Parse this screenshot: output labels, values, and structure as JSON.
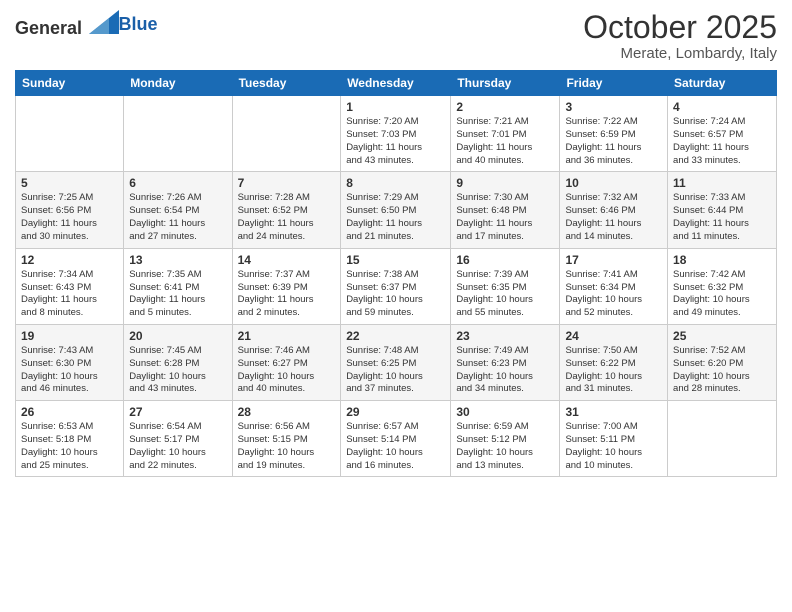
{
  "logo": {
    "general": "General",
    "blue": "Blue"
  },
  "title": {
    "month": "October 2025",
    "location": "Merate, Lombardy, Italy"
  },
  "days_of_week": [
    "Sunday",
    "Monday",
    "Tuesday",
    "Wednesday",
    "Thursday",
    "Friday",
    "Saturday"
  ],
  "weeks": [
    [
      {
        "day": "",
        "info": ""
      },
      {
        "day": "",
        "info": ""
      },
      {
        "day": "",
        "info": ""
      },
      {
        "day": "1",
        "info": "Sunrise: 7:20 AM\nSunset: 7:03 PM\nDaylight: 11 hours\nand 43 minutes."
      },
      {
        "day": "2",
        "info": "Sunrise: 7:21 AM\nSunset: 7:01 PM\nDaylight: 11 hours\nand 40 minutes."
      },
      {
        "day": "3",
        "info": "Sunrise: 7:22 AM\nSunset: 6:59 PM\nDaylight: 11 hours\nand 36 minutes."
      },
      {
        "day": "4",
        "info": "Sunrise: 7:24 AM\nSunset: 6:57 PM\nDaylight: 11 hours\nand 33 minutes."
      }
    ],
    [
      {
        "day": "5",
        "info": "Sunrise: 7:25 AM\nSunset: 6:56 PM\nDaylight: 11 hours\nand 30 minutes."
      },
      {
        "day": "6",
        "info": "Sunrise: 7:26 AM\nSunset: 6:54 PM\nDaylight: 11 hours\nand 27 minutes."
      },
      {
        "day": "7",
        "info": "Sunrise: 7:28 AM\nSunset: 6:52 PM\nDaylight: 11 hours\nand 24 minutes."
      },
      {
        "day": "8",
        "info": "Sunrise: 7:29 AM\nSunset: 6:50 PM\nDaylight: 11 hours\nand 21 minutes."
      },
      {
        "day": "9",
        "info": "Sunrise: 7:30 AM\nSunset: 6:48 PM\nDaylight: 11 hours\nand 17 minutes."
      },
      {
        "day": "10",
        "info": "Sunrise: 7:32 AM\nSunset: 6:46 PM\nDaylight: 11 hours\nand 14 minutes."
      },
      {
        "day": "11",
        "info": "Sunrise: 7:33 AM\nSunset: 6:44 PM\nDaylight: 11 hours\nand 11 minutes."
      }
    ],
    [
      {
        "day": "12",
        "info": "Sunrise: 7:34 AM\nSunset: 6:43 PM\nDaylight: 11 hours\nand 8 minutes."
      },
      {
        "day": "13",
        "info": "Sunrise: 7:35 AM\nSunset: 6:41 PM\nDaylight: 11 hours\nand 5 minutes."
      },
      {
        "day": "14",
        "info": "Sunrise: 7:37 AM\nSunset: 6:39 PM\nDaylight: 11 hours\nand 2 minutes."
      },
      {
        "day": "15",
        "info": "Sunrise: 7:38 AM\nSunset: 6:37 PM\nDaylight: 10 hours\nand 59 minutes."
      },
      {
        "day": "16",
        "info": "Sunrise: 7:39 AM\nSunset: 6:35 PM\nDaylight: 10 hours\nand 55 minutes."
      },
      {
        "day": "17",
        "info": "Sunrise: 7:41 AM\nSunset: 6:34 PM\nDaylight: 10 hours\nand 52 minutes."
      },
      {
        "day": "18",
        "info": "Sunrise: 7:42 AM\nSunset: 6:32 PM\nDaylight: 10 hours\nand 49 minutes."
      }
    ],
    [
      {
        "day": "19",
        "info": "Sunrise: 7:43 AM\nSunset: 6:30 PM\nDaylight: 10 hours\nand 46 minutes."
      },
      {
        "day": "20",
        "info": "Sunrise: 7:45 AM\nSunset: 6:28 PM\nDaylight: 10 hours\nand 43 minutes."
      },
      {
        "day": "21",
        "info": "Sunrise: 7:46 AM\nSunset: 6:27 PM\nDaylight: 10 hours\nand 40 minutes."
      },
      {
        "day": "22",
        "info": "Sunrise: 7:48 AM\nSunset: 6:25 PM\nDaylight: 10 hours\nand 37 minutes."
      },
      {
        "day": "23",
        "info": "Sunrise: 7:49 AM\nSunset: 6:23 PM\nDaylight: 10 hours\nand 34 minutes."
      },
      {
        "day": "24",
        "info": "Sunrise: 7:50 AM\nSunset: 6:22 PM\nDaylight: 10 hours\nand 31 minutes."
      },
      {
        "day": "25",
        "info": "Sunrise: 7:52 AM\nSunset: 6:20 PM\nDaylight: 10 hours\nand 28 minutes."
      }
    ],
    [
      {
        "day": "26",
        "info": "Sunrise: 6:53 AM\nSunset: 5:18 PM\nDaylight: 10 hours\nand 25 minutes."
      },
      {
        "day": "27",
        "info": "Sunrise: 6:54 AM\nSunset: 5:17 PM\nDaylight: 10 hours\nand 22 minutes."
      },
      {
        "day": "28",
        "info": "Sunrise: 6:56 AM\nSunset: 5:15 PM\nDaylight: 10 hours\nand 19 minutes."
      },
      {
        "day": "29",
        "info": "Sunrise: 6:57 AM\nSunset: 5:14 PM\nDaylight: 10 hours\nand 16 minutes."
      },
      {
        "day": "30",
        "info": "Sunrise: 6:59 AM\nSunset: 5:12 PM\nDaylight: 10 hours\nand 13 minutes."
      },
      {
        "day": "31",
        "info": "Sunrise: 7:00 AM\nSunset: 5:11 PM\nDaylight: 10 hours\nand 10 minutes."
      },
      {
        "day": "",
        "info": ""
      }
    ]
  ]
}
